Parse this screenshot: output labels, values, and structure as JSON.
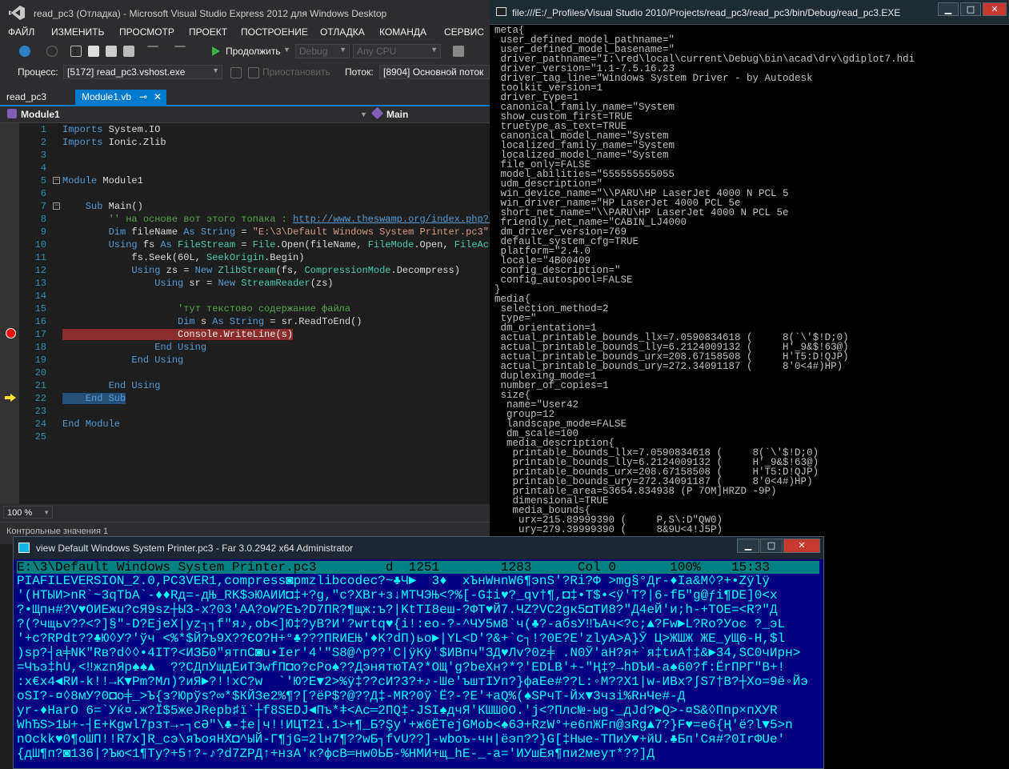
{
  "vs": {
    "title": "read_pc3 (Отладка) - Microsoft Visual Studio Express 2012 для Windows Desktop",
    "menu": [
      "ФАЙЛ",
      "ИЗМЕНИТЬ",
      "ПРОСМОТР",
      "ПРОЕКТ",
      "ПОСТРОЕНИЕ",
      "ОТЛАДКА",
      "КОМАНДА",
      "СЕРВИС"
    ],
    "toolbar": {
      "continue_label": "Продолжить",
      "config": "Debug",
      "platform": "Any CPU"
    },
    "debug_bar": {
      "process_label": "Процесс:",
      "process_value": "[5172] read_pc3.vshost.exe",
      "suspend_label": "Приостановить",
      "thread_label": "Поток:",
      "thread_value": "[8904] Основной поток"
    },
    "tabs": {
      "project_tab": "read_pc3",
      "file_tab": "Module1.vb",
      "pin": "⊸",
      "close": "✕"
    },
    "navbar": {
      "left": "Module1",
      "right": "Main"
    },
    "lines": [
      {
        "n": "1",
        "t": [
          [
            "kw",
            "Imports"
          ],
          [
            "",
            "System.IO"
          ]
        ]
      },
      {
        "n": "2",
        "t": [
          [
            "kw",
            "Imports"
          ],
          [
            "",
            "Ionic.Zlib"
          ]
        ]
      },
      {
        "n": "3",
        "t": []
      },
      {
        "n": "4",
        "t": []
      },
      {
        "n": "5",
        "t": [
          [
            "kw",
            "Module"
          ],
          [
            "",
            "Module1"
          ]
        ]
      },
      {
        "n": "6",
        "t": []
      },
      {
        "n": "7",
        "t": [
          [
            "kw",
            "    Sub"
          ],
          [
            "",
            "Main()"
          ]
        ]
      },
      {
        "n": "8",
        "t": [
          [
            "cm",
            "        '' на основе вот этого топака : "
          ],
          [
            "link",
            "http://www.theswamp.org/index.php?to"
          ]
        ]
      },
      {
        "n": "9",
        "t": [
          [
            "kw",
            "        Dim"
          ],
          [
            "",
            "fileName"
          ],
          [
            "kw",
            "As"
          ],
          [
            "kw",
            "String"
          ],
          [
            "",
            "="
          ],
          [
            "st",
            "\"E:\\3\\Default Windows System Printer.pc3\""
          ]
        ]
      },
      {
        "n": "10",
        "t": [
          [
            "kw",
            "        Using"
          ],
          [
            "",
            "fs"
          ],
          [
            "kw",
            "As"
          ],
          [
            "ty",
            "FileStream"
          ],
          [
            "",
            "="
          ],
          [
            "ty",
            "File"
          ],
          [
            "",
            ".Open(fileName,"
          ],
          [
            "ty",
            "FileMode"
          ],
          [
            "",
            ".Open,"
          ],
          [
            "ty",
            "FileAcce"
          ]
        ]
      },
      {
        "n": "11",
        "t": [
          [
            "",
            "            fs.Seek(60L,"
          ],
          [
            "ty",
            "SeekOrigin"
          ],
          [
            "",
            ".Begin)"
          ]
        ]
      },
      {
        "n": "12",
        "t": [
          [
            "kw",
            "            Using"
          ],
          [
            "",
            "zs ="
          ],
          [
            "kw",
            "New"
          ],
          [
            "ty",
            "ZlibStream"
          ],
          [
            "",
            "(fs,"
          ],
          [
            "ty",
            "CompressionMode"
          ],
          [
            "",
            ".Decompress)"
          ]
        ]
      },
      {
        "n": "13",
        "t": [
          [
            "kw",
            "                Using"
          ],
          [
            "",
            "sr ="
          ],
          [
            "kw",
            "New"
          ],
          [
            "ty",
            "StreamReader"
          ],
          [
            "",
            "(zs)"
          ]
        ]
      },
      {
        "n": "14",
        "t": []
      },
      {
        "n": "15",
        "t": [
          [
            "cm",
            "                    'тут текстово содержание файла"
          ]
        ]
      },
      {
        "n": "16",
        "t": [
          [
            "kw",
            "                    Dim"
          ],
          [
            "",
            "s"
          ],
          [
            "kw",
            "As"
          ],
          [
            "kw",
            "String"
          ],
          [
            "",
            "= sr.ReadToEnd()"
          ]
        ]
      },
      {
        "n": "17",
        "t": [
          [
            "bp",
            "                    Console.WriteLine(s)"
          ]
        ]
      },
      {
        "n": "18",
        "t": [
          [
            "kw",
            "                End Using"
          ]
        ]
      },
      {
        "n": "19",
        "t": [
          [
            "kw",
            "            End Using"
          ]
        ]
      },
      {
        "n": "20",
        "t": []
      },
      {
        "n": "21",
        "t": [
          [
            "kw",
            "        End Using"
          ]
        ]
      },
      {
        "n": "22",
        "t": [
          [
            "sel",
            "    End Sub"
          ]
        ]
      },
      {
        "n": "23",
        "t": []
      },
      {
        "n": "24",
        "t": [
          [
            "kw",
            "End Module"
          ]
        ]
      },
      {
        "n": "25",
        "t": []
      }
    ],
    "zoom": "100 %",
    "bottom_label": "Контрольные значения 1"
  },
  "console": {
    "title": "file:///E:/_Profiles/Visual Studio 2010/Projects/read_pc3/read_pc3/bin/Debug/read_pc3.EXE",
    "lines": [
      "meta{",
      " user_defined_model_pathname=\"",
      " user_defined_model_basename=\"",
      " driver_pathname=\"I:\\red\\local\\current\\Debug\\bin\\acad\\drv\\gdiplot7.hdi",
      " driver_version=\"1.1-7.5.16.23",
      " driver_tag_line=\"Windows System Driver - by Autodesk",
      " toolkit_version=1",
      " driver_type=1",
      " canonical_family_name=\"System",
      " show_custom_first=TRUE",
      " truetype_as_text=TRUE",
      " canonical_model_name=\"System",
      " localized_family_name=\"System",
      " localized_model_name=\"System",
      " file_only=FALSE",
      " model_abilities=\"555555555055",
      " udm_description=\"",
      " win_device_name=\"\\\\PARU\\HP LaserJet 4000 N PCL 5",
      " win_driver_name=\"HP LaserJet 4000 PCL 5e",
      " short_net_name=\"\\\\PARU\\HP LaserJet 4000 N PCL 5e",
      " friendly_net_name=\"CABIN_LJ4000",
      " dm_driver_version=769",
      " default_system_cfg=TRUE",
      " platform=\"2.4.0",
      " locale=\"4B00409",
      " config_description=\"",
      " config_autospool=FALSE",
      "}",
      "media{",
      " selection_method=2",
      " type=\"",
      " dm_orientation=1",
      " actual_printable_bounds_llx=7.0590834618 (     8(`\\'$!D;0)",
      " actual_printable_bounds_lly=6.2124009132 (     H'_9&$!63@)",
      " actual_printable_bounds_urx=208.67158508 (     H'T5:D!QJP)",
      " actual_printable_bounds_ury=272.34091187 (     8'0<4#)HP)",
      " duplexing_mode=1",
      " number_of_copies=1",
      " size{",
      "  name=\"User42",
      "  group=12",
      "  landscape_mode=FALSE",
      "  dm_scale=100",
      "  media_description{",
      "   printable_bounds_llx=7.0590834618 (     8(`\\'$!D;0)",
      "   printable_bounds_lly=6.2124009132 (     H'_9&$!63@)",
      "   printable_bounds_urx=208.67158508 (     H'T5:D!QJP)",
      "   printable_bounds_ury=272.34091187 (     8'0<4#)HP)",
      "   printable_area=53654.834938 (P 7OM]HRZD -9P)",
      "   dimensional=TRUE",
      "   media_bounds{",
      "    urx=215.89999390 (     P,S\\:D\"QW0)",
      "    ury=279.39999390 (     8&9U<4!J5P)"
    ]
  },
  "far": {
    "title": "view Default Windows System Printer.pc3 - Far 3.0.2942 x64 Administrator",
    "status": "E:\\3\\Default Windows System Printer.pc3         d  1251        1283      Col 0       100%    15:33",
    "lines": [
      "PIAFILEVERSION_2.0,PC3VER1,compress◙pmzlibcodec?~♣Ч►  3♦  хЪнWнnW6¶эnS'?Ri?Ф >mg§°Дr-♦Ia&M◊?+•Zÿlÿ",
      "'(HTЫИ>nR`~3qТbА`-♦♦Rд=-дЊ_RK$эЮАИИ◘‡+?g,\"c?XBr+з↓МТЧЭЊ<?%[-G‡i♥?_qv†¶,◘‡•T$•<ÿ'T?|6-fБ\"g@ƒi¶DE]0<x",
      "?•Щпн#?V♥ОИЕжu?сЯ9sz┼Ы3-x?03'АА?oW?Еъ?D7ПR?¶щж:ъ?|KtTI8еш-?ФТ♥Й7.ЧZ?VC2gк5◘ТИ8?\"Д4еЙ'и;h-+TOE=<R?\"Д",
      "?(?чщьv??<?]§\"-D?EjeX|уz┐┐f\"я♪,ob<]Ю‡?уВ?И'?wrtq♥{i!:eо-?-^ЧУ5м8`ч(♣?-aбsУ‼ЪАч<?c;▲?Fw►L?Ro?Уоє ?_эL",
      "'+c?RPdt??♣Ю◊У?'ўч <%*$Й?ъ9Х??ЄО?H+°♣???ПRИЕЊ'♦K?dП)ьо►|YL<D'?&+`c┐!?0E?E'zlуА>А}Ӯ Ц>ЖШЖ ЖЕ_уЩ6-H,$l",
      ")sp?┤a╪NK\"Rв?d◊◊•4IT?<ИЗБ0\"ятпС◙u•Ier'4'\"S8@^p??'C|ÿКÿ'$ИВпч\"ЗД♥Лv?0z╪ .N0Ў'аН?я+`я‡tиА†‡&►34,SC0чИрн>",
      "=Чъэ‡hU,<‼жznЯр♠♠▲  ??CДпУщдЕиТЭwfП◘o?cPo♠??ДэнятюТА?*ОЩ'g?beXн?*?'EDLB'+-\"Ң‡?→hDЪИ-а♠60?f:ЁrПРГ\"В+!",
      ":x€x4◄RИ-k!!→K▼Pm?Mл)?иЯ►?!!xC?w  `'Ю?Е▼2>%ÿ‡??cИ?3?+♪-Шe'ъштІУп?}фаЕe#??L:◦M??X1|w-ИВх?∫S7†В?┼Xo=9ё◦Йэ",
      "oSI?-¤◊8мУ?0◘o╪_>Ъ{з?Юрўs?∞*$КЙЗе2%¶?[?ёР$?@??Д‡-MR?0ў`Ё?-?Е'+аQ%(♠SPчТ-Йх▼3чзi%RнЧе#-Д",
      "уr-♦HarO 6=`Уќ¤.ж?Ї$5жеJRepb♯ï`┼f8SEDJ◄Пъ*ǂ<Ac═2ПQ‡-JSI♠дчЯ'КШШ0О.'j<?Плс№-ыg-_дJd?►Q>-¤S&◊Ппр×пXУR",
      "WhЂS>1Ы+-┤E+Kgwl7рзт→-┐сӘ\"\\♣-‡e|ч!!ИЦТ2ї.1>+¶_Б?Şу'+ж6ЁТеjGMob<♠6Э+RzW°+e6пЖFп@зRg▲7?}F♥=e6{Ң'ё?l▼5>n",
      "nOckk♥0¶оШП!!R7х]R_сэ\\яЪояНХ◘^ЫЙ-Г¶јG=2lн7¶??wБ┐fvU??]-wboъ-чн|ёэп??}G[‡Ныe-ТПиУ▼+йU.♣Бп'Ся#?0IrФUе'",
      "{дШ¶п?◙136|?Ъю<1¶Ту?+5↑?-♪?d7ZPД↑+нзА'к?фсВ═нw0ЬБ-%НМИ+щ_hЕ-_-а='ИУшЕя¶пи2меут*??]Д"
    ]
  }
}
